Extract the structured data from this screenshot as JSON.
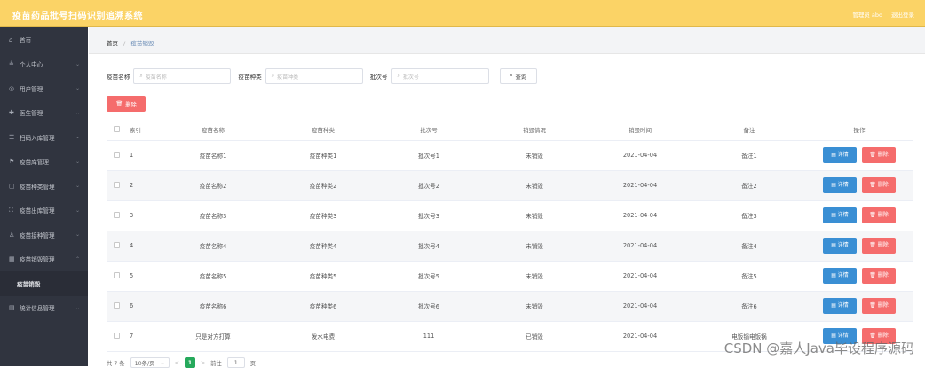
{
  "header": {
    "title": "疫苗药品批号扫码识别追溯系统",
    "user_label": "管理员 abo",
    "logout": "退出登录"
  },
  "sidebar": {
    "items": [
      {
        "icon": "⌂",
        "label": "首页",
        "chev": ""
      },
      {
        "icon": "≗",
        "label": "个人中心",
        "chev": "⌄"
      },
      {
        "icon": "◎",
        "label": "用户管理",
        "chev": "⌄"
      },
      {
        "icon": "✚",
        "label": "医生管理",
        "chev": "⌄"
      },
      {
        "icon": "☰",
        "label": "扫码入库管理",
        "chev": "⌄"
      },
      {
        "icon": "⚑",
        "label": "疫苗库管理",
        "chev": "⌄"
      },
      {
        "icon": "▢",
        "label": "疫苗种类管理",
        "chev": "⌄"
      },
      {
        "icon": "⛶",
        "label": "疫苗出库管理",
        "chev": "⌄"
      },
      {
        "icon": "♙",
        "label": "疫苗接种管理",
        "chev": "⌄"
      },
      {
        "icon": "▦",
        "label": "疫苗销毁管理",
        "chev": "⌃"
      },
      {
        "icon": "",
        "label": "疫苗销毁",
        "chev": "",
        "sub": true
      },
      {
        "icon": "▤",
        "label": "统计信息管理",
        "chev": "⌄"
      }
    ]
  },
  "breadcrumb": {
    "home": "首页",
    "sep": "/",
    "current": "疫苗销毁"
  },
  "search": {
    "name_label": "疫苗名称",
    "name_placeholder": "疫苗名称",
    "type_label": "疫苗种类",
    "type_placeholder": "疫苗种类",
    "batch_label": "批次号",
    "batch_placeholder": "批次号",
    "button": "查询"
  },
  "toolbar": {
    "delete_label": "删除"
  },
  "table": {
    "headers": [
      "",
      "索引",
      "疫苗名称",
      "疫苗种类",
      "批次号",
      "销毁情况",
      "销毁时间",
      "备注",
      "操作"
    ],
    "rows": [
      [
        "1",
        "疫苗名称1",
        "疫苗种类1",
        "批次号1",
        "未销毁",
        "2021-04-04",
        "备注1"
      ],
      [
        "2",
        "疫苗名称2",
        "疫苗种类2",
        "批次号2",
        "未销毁",
        "2021-04-04",
        "备注2"
      ],
      [
        "3",
        "疫苗名称3",
        "疫苗种类3",
        "批次号3",
        "未销毁",
        "2021-04-04",
        "备注3"
      ],
      [
        "4",
        "疫苗名称4",
        "疫苗种类4",
        "批次号4",
        "未销毁",
        "2021-04-04",
        "备注4"
      ],
      [
        "5",
        "疫苗名称5",
        "疫苗种类5",
        "批次号5",
        "未销毁",
        "2021-04-04",
        "备注5"
      ],
      [
        "6",
        "疫苗名称6",
        "疫苗种类6",
        "批次号6",
        "未销毁",
        "2021-04-04",
        "备注6"
      ],
      [
        "7",
        "只是对方打算",
        "发水电费",
        "111",
        "已销毁",
        "2021-04-04",
        "电饭锅电饭锅"
      ]
    ],
    "detail_label": "详情",
    "delete_label": "删除"
  },
  "pager": {
    "total": "共 7 条",
    "size": "10条/页",
    "prev": "<",
    "page": "1",
    "next": ">",
    "goto": "前往",
    "goto_value": "1",
    "page_unit": "页"
  },
  "watermark": "CSDN @嘉人Java毕设程序源码",
  "colors": {
    "header": "#fbd366",
    "sidebar": "#30343f",
    "danger": "#f56c6c",
    "primary": "#3a8fd4",
    "pager_active": "#26a95c"
  }
}
